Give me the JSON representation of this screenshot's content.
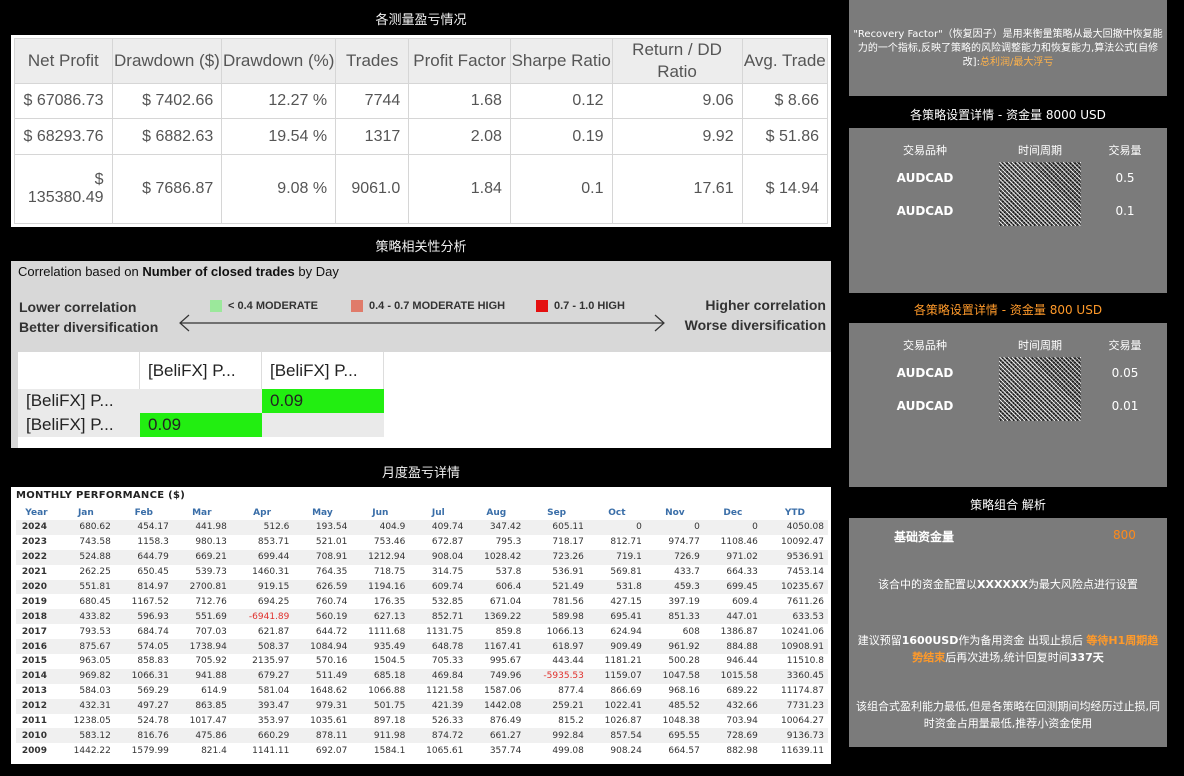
{
  "headings": {
    "profit_loss": "各测量盈亏情况",
    "correlation": "策略相关性分析",
    "monthly": "月度盈亏详情",
    "settings_8000": "各策略设置详情 - 资金量 8000 USD",
    "settings_800": "各策略设置详情 - 资金量 800 USD",
    "combo": "策略组合  解析"
  },
  "performance": {
    "headers": [
      "Net Profit",
      "Drawdown ($)",
      "Drawdown (%)",
      "Trades",
      "Profit Factor",
      "Sharpe Ratio",
      "Return / DD Ratio",
      "Avg. Trade"
    ],
    "rows": [
      [
        "$ 67086.73",
        "$ 7402.66",
        "12.27 %",
        "7744",
        "1.68",
        "0.12",
        "9.06",
        "$ 8.66"
      ],
      [
        "$ 68293.76",
        "$ 6882.63",
        "19.54 %",
        "1317",
        "2.08",
        "0.19",
        "9.92",
        "$ 51.86"
      ],
      [
        "$ 135380.49",
        "$ 7686.87",
        "9.08 %",
        "9061.0",
        "1.84",
        "0.1",
        "17.61",
        "$ 14.94"
      ]
    ]
  },
  "correlation": {
    "title_prefix": "Correlation based on ",
    "title_bold": "Number of closed trades",
    "title_suffix": " by Day",
    "lower_line1": "Lower correlation",
    "lower_line2": "Better diversification",
    "higher_line1": "Higher correlation",
    "higher_line2": "Worse diversification",
    "legend": [
      {
        "label": "< 0.4 MODERATE",
        "color": "#9be89b"
      },
      {
        "label": "0.4 - 0.7 MODERATE HIGH",
        "color": "#e07b6a"
      },
      {
        "label": "0.7 - 1.0 HIGH",
        "color": "#e41010"
      }
    ],
    "col_headers": [
      "[BeliFX] P...",
      "[BeliFX] P..."
    ],
    "row_headers": [
      "[BeliFX] P...",
      "[BeliFX] P..."
    ],
    "values": [
      "0.09",
      "0.09"
    ],
    "cell_color": "#22ee11"
  },
  "monthly": {
    "title": "MONTHLY PERFORMANCE ($)",
    "headers": [
      "Year",
      "Jan",
      "Feb",
      "Mar",
      "Apr",
      "May",
      "Jun",
      "Jul",
      "Aug",
      "Sep",
      "Oct",
      "Nov",
      "Dec",
      "YTD"
    ],
    "rows": [
      [
        "2024",
        "680.62",
        "454.17",
        "441.98",
        "512.6",
        "193.54",
        "404.9",
        "409.74",
        "347.42",
        "605.11",
        "0",
        "0",
        "0",
        "4050.08"
      ],
      [
        "2023",
        "743.58",
        "1158.3",
        "980.13",
        "853.71",
        "521.01",
        "753.46",
        "672.87",
        "795.3",
        "718.17",
        "812.71",
        "974.77",
        "1108.46",
        "10092.47"
      ],
      [
        "2022",
        "524.88",
        "644.79",
        "669.21",
        "699.44",
        "708.91",
        "1212.94",
        "908.04",
        "1028.42",
        "723.26",
        "719.1",
        "726.9",
        "971.02",
        "9536.91"
      ],
      [
        "2021",
        "262.25",
        "650.45",
        "539.73",
        "1460.31",
        "764.35",
        "718.75",
        "314.75",
        "537.8",
        "536.91",
        "569.81",
        "433.7",
        "664.33",
        "7453.14"
      ],
      [
        "2020",
        "551.81",
        "814.97",
        "2700.81",
        "919.15",
        "626.59",
        "1194.16",
        "609.74",
        "606.4",
        "521.49",
        "531.8",
        "459.3",
        "699.45",
        "10235.67"
      ],
      [
        "2019",
        "680.45",
        "1167.52",
        "712.76",
        "694.25",
        "760.74",
        "176.35",
        "532.85",
        "671.04",
        "781.56",
        "427.15",
        "397.19",
        "609.4",
        "7611.26"
      ],
      [
        "2018",
        "433.82",
        "596.93",
        "551.69",
        "-6941.89",
        "560.19",
        "627.13",
        "852.71",
        "1369.22",
        "589.98",
        "695.41",
        "851.33",
        "447.01",
        "633.53"
      ],
      [
        "2017",
        "793.53",
        "684.74",
        "707.03",
        "621.87",
        "644.72",
        "1111.68",
        "1131.75",
        "859.8",
        "1066.13",
        "624.94",
        "608",
        "1386.87",
        "10241.06"
      ],
      [
        "2016",
        "875.67",
        "574.05",
        "1738.94",
        "508.37",
        "1084.94",
        "935.49",
        "648.78",
        "1167.41",
        "618.97",
        "909.49",
        "961.92",
        "884.88",
        "10908.91"
      ],
      [
        "2015",
        "963.05",
        "858.83",
        "705.92",
        "2135.97",
        "570.16",
        "1504.5",
        "705.33",
        "995.67",
        "443.44",
        "1181.21",
        "500.28",
        "946.44",
        "11510.8"
      ],
      [
        "2014",
        "969.82",
        "1066.31",
        "941.88",
        "679.27",
        "511.49",
        "685.18",
        "469.84",
        "749.96",
        "-5935.53",
        "1159.07",
        "1047.58",
        "1015.58",
        "3360.45"
      ],
      [
        "2013",
        "584.03",
        "569.29",
        "614.9",
        "581.04",
        "1648.62",
        "1066.88",
        "1121.58",
        "1587.06",
        "877.4",
        "866.69",
        "968.16",
        "689.22",
        "11174.87"
      ],
      [
        "2012",
        "432.31",
        "497.27",
        "863.85",
        "393.47",
        "979.31",
        "501.75",
        "421.39",
        "1442.08",
        "259.21",
        "1022.41",
        "485.52",
        "432.66",
        "7731.23"
      ],
      [
        "2011",
        "1238.05",
        "524.78",
        "1017.47",
        "353.97",
        "1035.61",
        "897.18",
        "526.33",
        "876.49",
        "815.2",
        "1026.87",
        "1048.38",
        "703.94",
        "10064.27"
      ],
      [
        "2010",
        "583.12",
        "816.76",
        "475.86",
        "660.29",
        "878.11",
        "911.98",
        "874.72",
        "661.27",
        "992.84",
        "857.54",
        "695.55",
        "728.69",
        "9136.73"
      ],
      [
        "2009",
        "1442.22",
        "1579.99",
        "821.4",
        "1141.11",
        "692.07",
        "1584.1",
        "1065.61",
        "357.74",
        "499.08",
        "908.24",
        "664.57",
        "882.98",
        "11639.11"
      ]
    ]
  },
  "recovery_note": {
    "text1": "\"Recovery Factor\"（恢复因子）是用来衡量策略从最大回撤中恢复能力的一个指标,反映了策略的风险调整能力和恢复能力,算法公式[自修改]:",
    "highlight": "总利润/最大浮亏"
  },
  "settings_8000": {
    "headers": [
      "交易品种",
      "时间周期",
      "交易量"
    ],
    "rows": [
      [
        "AUDCAD",
        "0.5"
      ],
      [
        "AUDCAD",
        "0.1"
      ]
    ]
  },
  "settings_800": {
    "headers": [
      "交易品种",
      "时间周期",
      "交易量"
    ],
    "rows": [
      [
        "AUDCAD",
        "0.05"
      ],
      [
        "AUDCAD",
        "0.01"
      ]
    ]
  },
  "combo": {
    "base_label": "基础资金量",
    "base_value": "800",
    "line1_pre": "该合中的资金配置以",
    "line1_bold": "XXXXXX",
    "line1_post": "为最大风险点进行设置",
    "line2_pre": "建议预留",
    "line2_bold": "1600USD",
    "line2_mid": "作为备用资金 出现止损后 ",
    "line2_hl": "等待H1周期趋势结束",
    "line2_post": "后再次进场,统计回复时间",
    "line2_days": "337天",
    "line3": "该组合式盈利能力最低,但是各策略在回测期间均经历过止损,同时资金占用量最低,推荐小资金使用"
  }
}
